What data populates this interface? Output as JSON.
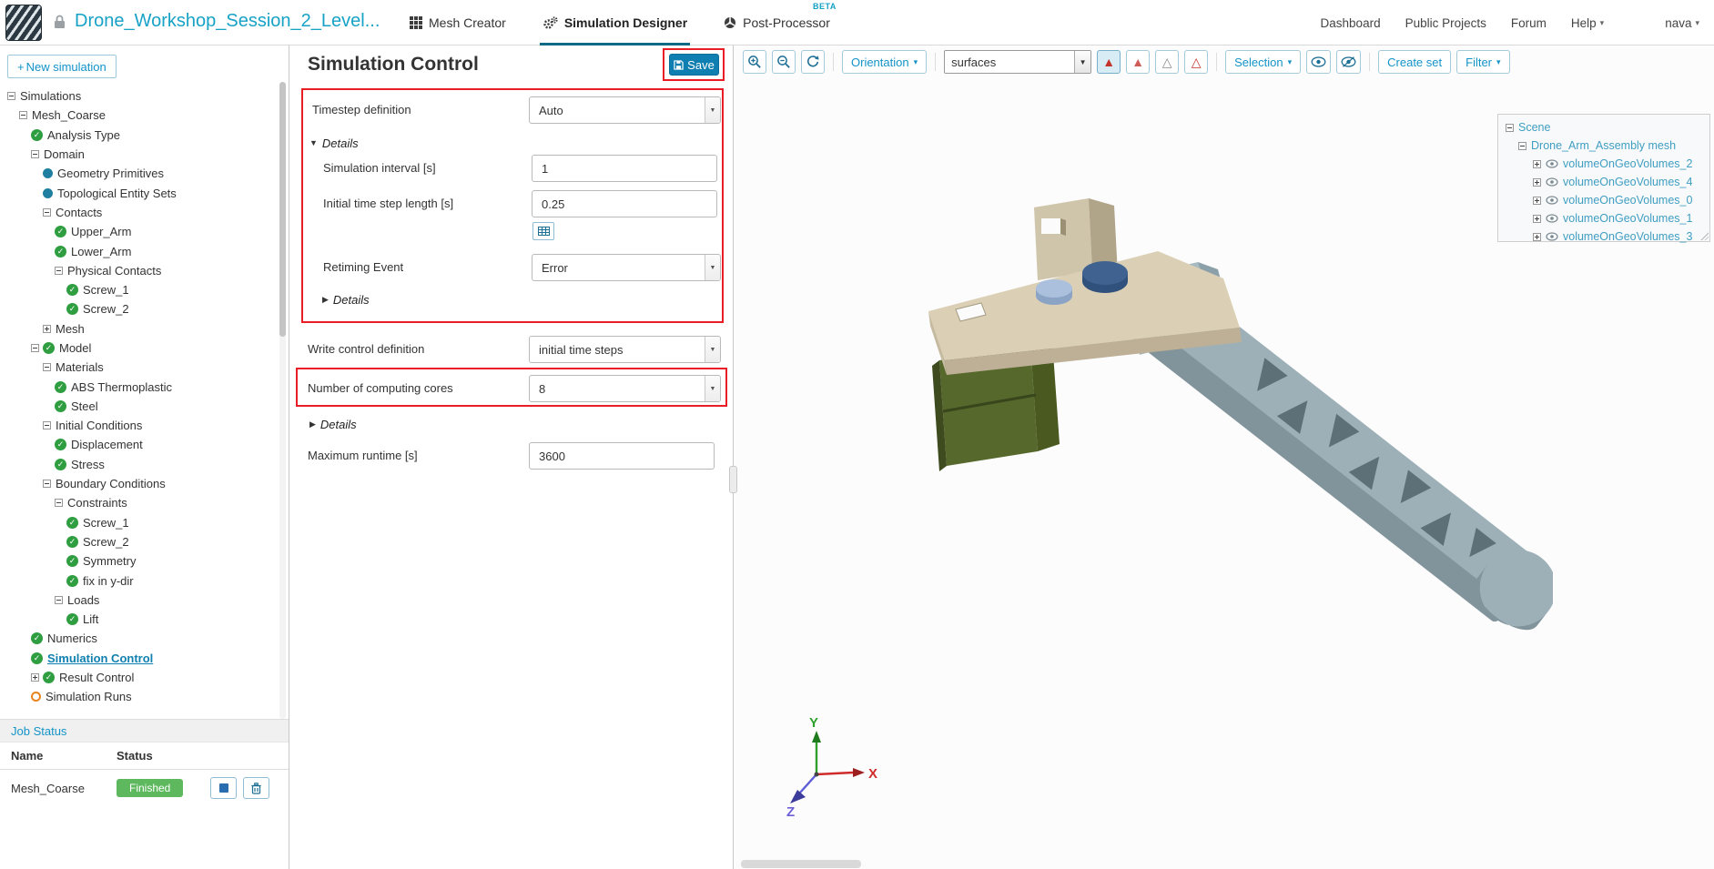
{
  "colors": {
    "accent": "#1493c8",
    "accent_dark": "#0e7fb0",
    "annotation_red": "#ea1c24",
    "success_green": "#5eb95e",
    "check_green": "#2f9e41",
    "entity_dot": "#1f7fa0",
    "runs_orange": "#e8821e",
    "active_tab_underline": "#0c6a85"
  },
  "icons": {
    "plus": "+",
    "caret_down": "▾",
    "select_arrow": "▼",
    "details_open_triangle": "▼",
    "details_closed_triangle": "▶",
    "triangle_filled": "▲",
    "triangle_outline": "△"
  },
  "header": {
    "project_title": "Drone_Workshop_Session_2_Level...",
    "tabs": [
      {
        "label": "Mesh Creator"
      },
      {
        "label": "Simulation Designer"
      },
      {
        "label": "Post-Processor",
        "badge": "BETA"
      }
    ],
    "links": [
      {
        "label": "Dashboard"
      },
      {
        "label": "Public Projects"
      },
      {
        "label": "Forum"
      },
      {
        "label": "Help"
      },
      {
        "label": "nava"
      }
    ]
  },
  "sidebar": {
    "new_simulation_label": "New simulation",
    "tree": [
      {
        "depth": 0,
        "icons": [
          "collapse"
        ],
        "label": "Simulations"
      },
      {
        "depth": 1,
        "icons": [
          "collapse"
        ],
        "label": "Mesh_Coarse"
      },
      {
        "depth": 2,
        "icons": [
          "check"
        ],
        "label": "Analysis Type"
      },
      {
        "depth": 2,
        "icons": [
          "collapse"
        ],
        "label": "Domain"
      },
      {
        "depth": 3,
        "icons": [
          "dot"
        ],
        "label": "Geometry Primitives"
      },
      {
        "depth": 3,
        "icons": [
          "dot"
        ],
        "label": "Topological Entity Sets"
      },
      {
        "depth": 3,
        "icons": [
          "collapse"
        ],
        "label": "Contacts"
      },
      {
        "depth": 4,
        "icons": [
          "check"
        ],
        "label": "Upper_Arm"
      },
      {
        "depth": 4,
        "icons": [
          "check"
        ],
        "label": "Lower_Arm"
      },
      {
        "depth": 4,
        "icons": [
          "collapse"
        ],
        "label": "Physical Contacts"
      },
      {
        "depth": 5,
        "icons": [
          "check"
        ],
        "label": "Screw_1"
      },
      {
        "depth": 5,
        "icons": [
          "check"
        ],
        "label": "Screw_2"
      },
      {
        "depth": 3,
        "icons": [
          "expand"
        ],
        "label": "Mesh"
      },
      {
        "depth": 2,
        "icons": [
          "collapse",
          "check"
        ],
        "label": "Model"
      },
      {
        "depth": 3,
        "icons": [
          "collapse"
        ],
        "label": "Materials"
      },
      {
        "depth": 4,
        "icons": [
          "check"
        ],
        "label": "ABS Thermoplastic"
      },
      {
        "depth": 4,
        "icons": [
          "check"
        ],
        "label": "Steel"
      },
      {
        "depth": 3,
        "icons": [
          "collapse"
        ],
        "label": "Initial Conditions"
      },
      {
        "depth": 4,
        "icons": [
          "check"
        ],
        "label": "Displacement"
      },
      {
        "depth": 4,
        "icons": [
          "check"
        ],
        "label": "Stress"
      },
      {
        "depth": 3,
        "icons": [
          "collapse"
        ],
        "label": "Boundary Conditions"
      },
      {
        "depth": 4,
        "icons": [
          "collapse"
        ],
        "label": "Constraints"
      },
      {
        "depth": 5,
        "icons": [
          "check"
        ],
        "label": "Screw_1"
      },
      {
        "depth": 5,
        "icons": [
          "check"
        ],
        "label": "Screw_2"
      },
      {
        "depth": 5,
        "icons": [
          "check"
        ],
        "label": "Symmetry"
      },
      {
        "depth": 5,
        "icons": [
          "check"
        ],
        "label": "fix in y-dir"
      },
      {
        "depth": 4,
        "icons": [
          "collapse"
        ],
        "label": "Loads"
      },
      {
        "depth": 5,
        "icons": [
          "check"
        ],
        "label": "Lift"
      },
      {
        "depth": 2,
        "icons": [
          "check"
        ],
        "label": "Numerics"
      },
      {
        "depth": 2,
        "icons": [
          "check"
        ],
        "label": "Simulation Control",
        "selected": true
      },
      {
        "depth": 2,
        "icons": [
          "expand",
          "check"
        ],
        "label": "Result Control"
      },
      {
        "depth": 2,
        "icons": [
          "ring"
        ],
        "label": "Simulation Runs"
      }
    ],
    "job_status": {
      "title": "Job Status",
      "col_name": "Name",
      "col_status": "Status",
      "rows": [
        {
          "name": "Mesh_Coarse",
          "status": "Finished"
        }
      ]
    }
  },
  "panel": {
    "title": "Simulation Control",
    "save_label": "Save",
    "timestep_label": "Timestep definition",
    "timestep_value": "Auto",
    "details_label": "Details",
    "interval_label": "Simulation interval [s]",
    "interval_value": "1",
    "initial_step_label": "Initial time step length [s]",
    "initial_step_value": "0.25",
    "retiming_label": "Retiming Event",
    "retiming_value": "Error",
    "write_control_label": "Write control definition",
    "write_control_value": "initial time steps",
    "cores_label": "Number of computing cores",
    "cores_value": "8",
    "runtime_label": "Maximum runtime [s]",
    "runtime_value": "3600"
  },
  "viewport": {
    "toolbar": {
      "orientation_label": "Orientation",
      "render_select_value": "surfaces",
      "selection_label": "Selection",
      "create_set_label": "Create set",
      "filter_label": "Filter"
    },
    "scene_tree": {
      "root_label": "Scene",
      "assembly_label": "Drone_Arm_Assembly mesh",
      "volumes": [
        "volumeOnGeoVolumes_2",
        "volumeOnGeoVolumes_4",
        "volumeOnGeoVolumes_0",
        "volumeOnGeoVolumes_1",
        "volumeOnGeoVolumes_3"
      ]
    },
    "axes": {
      "x": "X",
      "y": "Y",
      "z": "Z"
    }
  }
}
